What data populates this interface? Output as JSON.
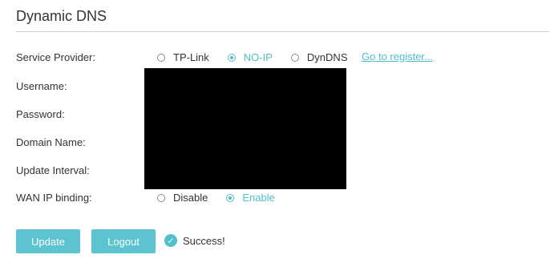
{
  "title": "Dynamic DNS",
  "fields": {
    "service_provider": "Service Provider:",
    "username": "Username:",
    "password": "Password:",
    "domain_name": "Domain Name:",
    "update_interval": "Update Interval:",
    "wan_ip_binding": "WAN IP binding:"
  },
  "providers": {
    "tplink": "TP-Link",
    "noip": "NO-IP",
    "dyndns": "DynDNS",
    "selected": "NO-IP"
  },
  "register_link": "Go to register...",
  "binding": {
    "disable": "Disable",
    "enable": "Enable",
    "selected": "Enable"
  },
  "buttons": {
    "update": "Update",
    "logout": "Logout"
  },
  "status": "Success!",
  "colors": {
    "accent": "#4dbfce",
    "button": "#5cc4d1"
  }
}
